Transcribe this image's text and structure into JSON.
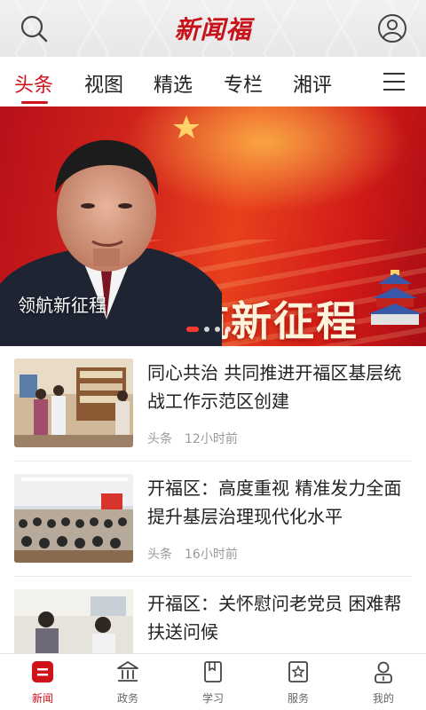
{
  "header": {
    "logo": "新闻福"
  },
  "tabs": [
    "头条",
    "视图",
    "精选",
    "专栏",
    "湘评"
  ],
  "banner": {
    "graphic_text": "领航新征程",
    "caption": "领航新征程",
    "dots": 4,
    "active_dot": 0
  },
  "news": [
    {
      "title": "同心共治 共同推进开福区基层统战工作示范区创建",
      "channel": "头条",
      "time": "12小时前"
    },
    {
      "title": "开福区：高度重视 精准发力全面提升基层治理现代化水平",
      "channel": "头条",
      "time": "16小时前"
    },
    {
      "title": "开福区：关怀慰问老党员 困难帮扶送问候",
      "channel": "",
      "time": ""
    }
  ],
  "bottom_nav": [
    {
      "label": "新闻",
      "icon": "news-icon",
      "active": true
    },
    {
      "label": "政务",
      "icon": "government-icon",
      "active": false
    },
    {
      "label": "学习",
      "icon": "study-icon",
      "active": false
    },
    {
      "label": "服务",
      "icon": "service-icon",
      "active": false
    },
    {
      "label": "我的",
      "icon": "profile-icon",
      "active": false
    }
  ],
  "colors": {
    "accent": "#d0121b",
    "banner": "#d5271c"
  }
}
